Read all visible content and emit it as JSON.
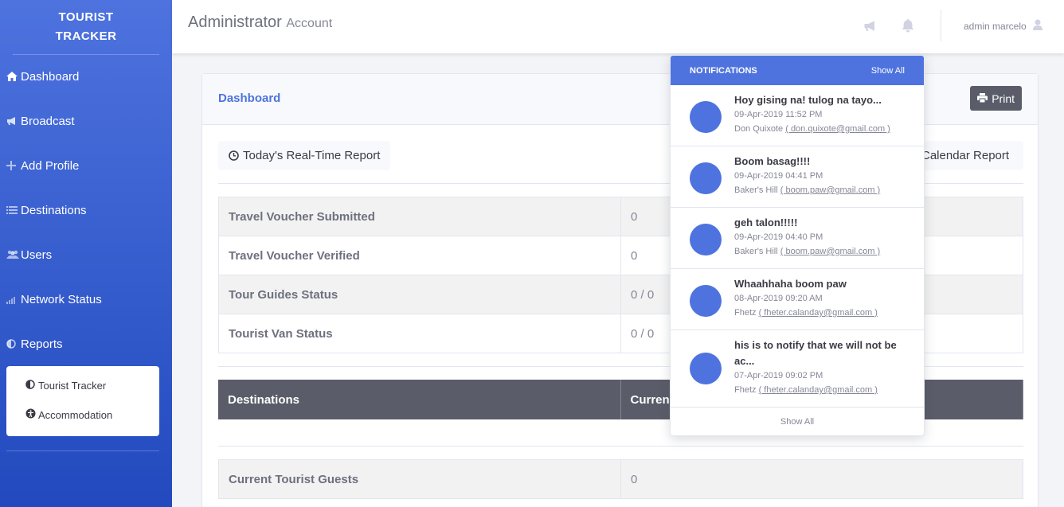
{
  "brand": {
    "line1": "TOURIST",
    "line2": "TRACKER"
  },
  "sidebar": {
    "items": [
      {
        "label": "Dashboard",
        "icon": "home-icon"
      },
      {
        "label": "Broadcast",
        "icon": "bullhorn-icon"
      },
      {
        "label": "Add Profile",
        "icon": "plus-icon"
      },
      {
        "label": "Destinations",
        "icon": "list-icon"
      },
      {
        "label": "Users",
        "icon": "users-icon"
      },
      {
        "label": "Network Status",
        "icon": "signal-icon"
      },
      {
        "label": "Reports",
        "icon": "adjust-icon"
      }
    ],
    "submenu": [
      {
        "label": "Tourist Tracker",
        "icon": "adjust-icon"
      },
      {
        "label": "Accommodation",
        "icon": "universal-access-icon"
      }
    ]
  },
  "topbar": {
    "title": "Administrator",
    "subtitle": "Account",
    "user_name": "admin marcelo"
  },
  "card": {
    "title": "Dashboard",
    "print_label": "Print",
    "realtime_label": "Today's Real-Time Report",
    "calendar_label": "Calendar Report"
  },
  "stats": [
    {
      "label": "Travel Voucher Submitted",
      "value": "0"
    },
    {
      "label": "Travel Voucher Verified",
      "value": "0"
    },
    {
      "label": "Tour Guides Status",
      "value": "0 / 0"
    },
    {
      "label": "Tourist Van Status",
      "value": "0 / 0"
    }
  ],
  "destinations_table": {
    "col1": "Destinations",
    "col2": "Curren"
  },
  "guests": {
    "label": "Current Tourist Guests",
    "value": "0"
  },
  "notifications": {
    "header": "NOTIFICATIONS",
    "show_all_top": "Show All",
    "show_all_bottom": "Show All",
    "items": [
      {
        "message": "Hoy gising na! tulog na tayo...",
        "time": "09-Apr-2019 11:52 PM",
        "sender": "Don Quixote",
        "email": "( don.quixote@gmail.com )"
      },
      {
        "message": "Boom basag!!!!",
        "time": "09-Apr-2019 04:41 PM",
        "sender": "Baker's Hill",
        "email": "( boom.paw@gmail.com )"
      },
      {
        "message": "geh talon!!!!!",
        "time": "09-Apr-2019 04:40 PM",
        "sender": "Baker's Hill",
        "email": "( boom.paw@gmail.com )"
      },
      {
        "message": "Whaahhaha boom paw",
        "time": "08-Apr-2019 09:20 AM",
        "sender": "Fhetz",
        "email": "( fheter.calanday@gmail.com )"
      },
      {
        "message": "his is to notify that we will not be ac...",
        "time": "07-Apr-2019 09:02 PM",
        "sender": "Fhetz",
        "email": "( fheter.calanday@gmail.com )"
      }
    ]
  },
  "colors": {
    "primary": "#4e73df",
    "sidebar_dark": "#224abe",
    "gray_dark": "#5a5c69"
  }
}
